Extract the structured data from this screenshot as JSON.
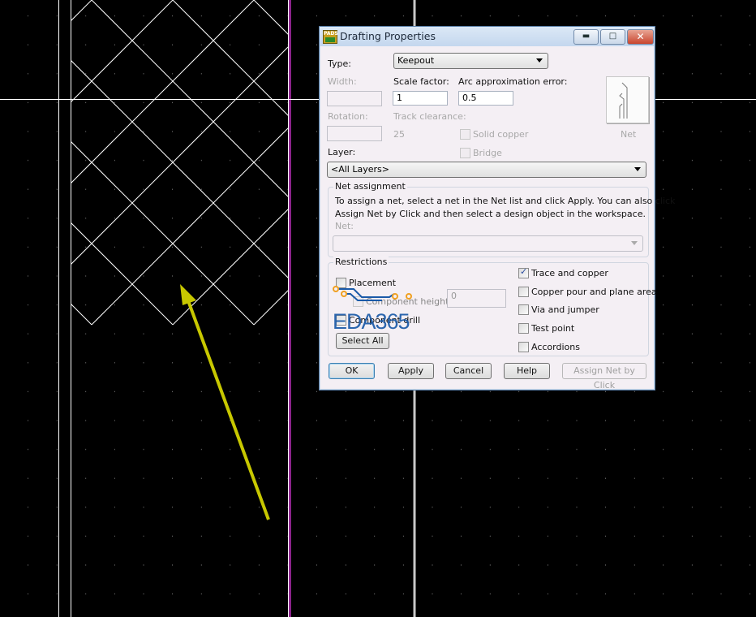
{
  "dialog": {
    "title": "Drafting Properties",
    "type_label": "Type:",
    "type_value": "Keepout",
    "width_label": "Width:",
    "width_value": "",
    "scale_label": "Scale factor:",
    "scale_value": "1",
    "arc_label": "Arc approximation error:",
    "arc_value": "0.5",
    "rotation_label": "Rotation:",
    "rotation_value": "",
    "track_clearance_label": "Track clearance:",
    "track_clearance_value": "25",
    "solid_copper_label": "Solid copper",
    "bridge_label": "Bridge",
    "net_button_label": "Net",
    "layer_label": "Layer:",
    "layer_value": "<All Layers>",
    "net_assignment": {
      "title": "Net assignment",
      "help_line1": "To assign a net, select a net in the Net list and click Apply. You can also click",
      "help_line2": "Assign Net by Click and then select a design object in the workspace.",
      "net_label": "Net:",
      "net_value": ""
    },
    "restrictions": {
      "title": "Restrictions",
      "placement": {
        "label": "Placement",
        "checked": false
      },
      "component_height": {
        "label": "Component height",
        "checked": false,
        "value": "0"
      },
      "component_drill": {
        "label": "Component drill",
        "checked": false
      },
      "select_all": "Select All",
      "right": [
        {
          "label": "Trace and copper",
          "checked": true
        },
        {
          "label": "Copper pour and plane area",
          "checked": false
        },
        {
          "label": "Via and jumper",
          "checked": false
        },
        {
          "label": "Test point",
          "checked": false
        },
        {
          "label": "Accordions",
          "checked": false
        }
      ]
    },
    "buttons": {
      "ok": "OK",
      "apply": "Apply",
      "cancel": "Cancel",
      "help": "Help",
      "assign": "Assign Net by Click"
    },
    "app_icon_text": "PADS"
  },
  "watermark": "EDA365",
  "colors": {
    "background": "#000000",
    "hatch": "#ffffff",
    "outline": "#cc33cc",
    "arrow": "#c8c800",
    "watermark": "#1a5aa8"
  }
}
